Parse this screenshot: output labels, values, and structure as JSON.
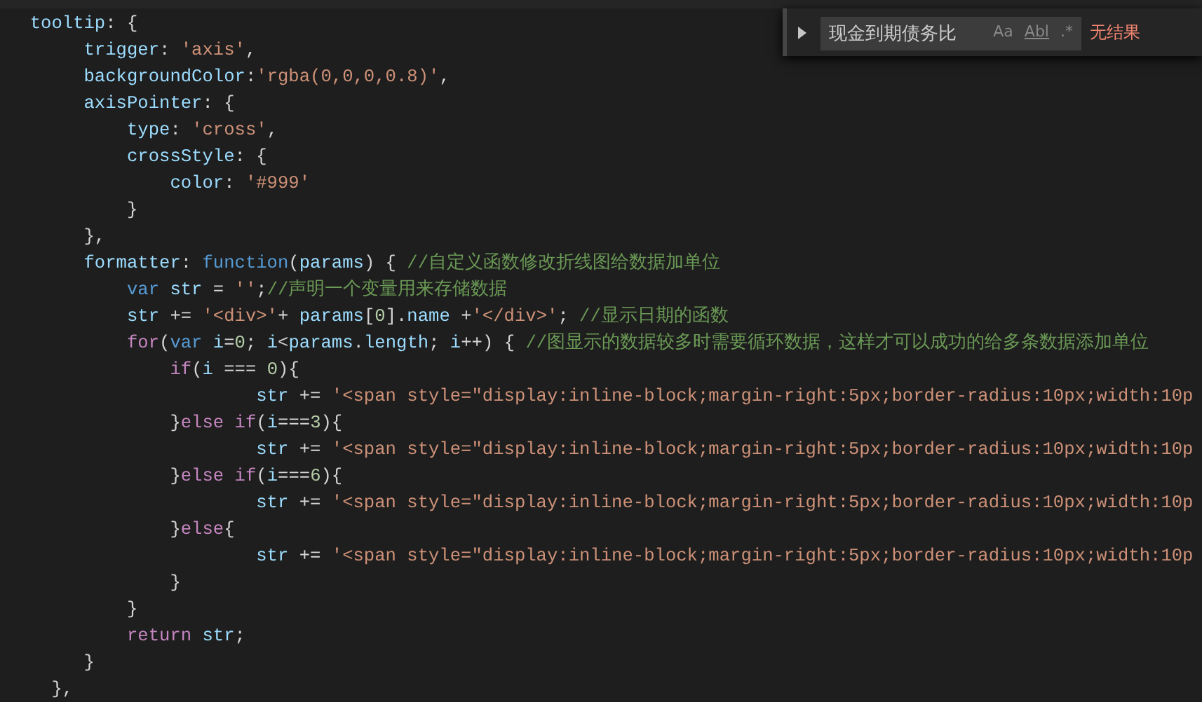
{
  "code_lines": [
    {
      "tokens": [
        {
          "kind": "prop",
          "text": "  tooltip"
        },
        {
          "kind": "plain",
          "text": ": {"
        }
      ]
    },
    {
      "tokens": [
        {
          "kind": "prop",
          "text": "       trigger"
        },
        {
          "kind": "plain",
          "text": ": "
        },
        {
          "kind": "str",
          "text": "'axis'"
        },
        {
          "kind": "plain",
          "text": ","
        }
      ]
    },
    {
      "tokens": [
        {
          "kind": "prop",
          "text": "       backgroundColor"
        },
        {
          "kind": "plain",
          "text": ":"
        },
        {
          "kind": "str",
          "text": "'rgba(0,0,0,0.8)'"
        },
        {
          "kind": "plain",
          "text": ","
        }
      ]
    },
    {
      "tokens": [
        {
          "kind": "prop",
          "text": "       axisPointer"
        },
        {
          "kind": "plain",
          "text": ": {"
        }
      ]
    },
    {
      "tokens": [
        {
          "kind": "prop",
          "text": "           type"
        },
        {
          "kind": "plain",
          "text": ": "
        },
        {
          "kind": "str",
          "text": "'cross'"
        },
        {
          "kind": "plain",
          "text": ","
        }
      ]
    },
    {
      "tokens": [
        {
          "kind": "prop",
          "text": "           crossStyle"
        },
        {
          "kind": "plain",
          "text": ": {"
        }
      ]
    },
    {
      "tokens": [
        {
          "kind": "prop",
          "text": "               color"
        },
        {
          "kind": "plain",
          "text": ": "
        },
        {
          "kind": "str",
          "text": "'#999'"
        }
      ]
    },
    {
      "tokens": [
        {
          "kind": "plain",
          "text": "           }"
        }
      ]
    },
    {
      "tokens": [
        {
          "kind": "plain",
          "text": "       },"
        }
      ]
    },
    {
      "tokens": [
        {
          "kind": "prop",
          "text": "       formatter"
        },
        {
          "kind": "plain",
          "text": ": "
        },
        {
          "kind": "kw",
          "text": "function"
        },
        {
          "kind": "plain",
          "text": "("
        },
        {
          "kind": "prop",
          "text": "params"
        },
        {
          "kind": "plain",
          "text": ") { "
        },
        {
          "kind": "comment",
          "text": "//自定义函数修改折线图给数据加单位"
        }
      ]
    },
    {
      "tokens": [
        {
          "kind": "kw",
          "text": "           var "
        },
        {
          "kind": "prop",
          "text": "str"
        },
        {
          "kind": "plain",
          "text": " = "
        },
        {
          "kind": "str",
          "text": "''"
        },
        {
          "kind": "plain",
          "text": ";"
        },
        {
          "kind": "comment",
          "text": "//声明一个变量用来存储数据"
        }
      ]
    },
    {
      "tokens": [
        {
          "kind": "prop",
          "text": "           str"
        },
        {
          "kind": "plain",
          "text": " += "
        },
        {
          "kind": "str",
          "text": "'<div>'"
        },
        {
          "kind": "plain",
          "text": "+ "
        },
        {
          "kind": "prop",
          "text": "params"
        },
        {
          "kind": "plain",
          "text": "["
        },
        {
          "kind": "num",
          "text": "0"
        },
        {
          "kind": "plain",
          "text": "]."
        },
        {
          "kind": "prop",
          "text": "name"
        },
        {
          "kind": "plain",
          "text": " +"
        },
        {
          "kind": "str",
          "text": "'</div>'"
        },
        {
          "kind": "plain",
          "text": "; "
        },
        {
          "kind": "comment",
          "text": "//显示日期的函数"
        }
      ]
    },
    {
      "tokens": [
        {
          "kind": "ctrl",
          "text": "           for"
        },
        {
          "kind": "plain",
          "text": "("
        },
        {
          "kind": "kw",
          "text": "var "
        },
        {
          "kind": "prop",
          "text": "i"
        },
        {
          "kind": "plain",
          "text": "="
        },
        {
          "kind": "num",
          "text": "0"
        },
        {
          "kind": "plain",
          "text": "; "
        },
        {
          "kind": "prop",
          "text": "i"
        },
        {
          "kind": "plain",
          "text": "<"
        },
        {
          "kind": "prop",
          "text": "params"
        },
        {
          "kind": "plain",
          "text": "."
        },
        {
          "kind": "prop",
          "text": "length"
        },
        {
          "kind": "plain",
          "text": "; "
        },
        {
          "kind": "prop",
          "text": "i"
        },
        {
          "kind": "plain",
          "text": "++) { "
        },
        {
          "kind": "comment",
          "text": "//图显示的数据较多时需要循环数据，这样才可以成功的给多条数据添加单位"
        }
      ]
    },
    {
      "tokens": [
        {
          "kind": "ctrl",
          "text": "               if"
        },
        {
          "kind": "plain",
          "text": "("
        },
        {
          "kind": "prop",
          "text": "i"
        },
        {
          "kind": "plain",
          "text": " === "
        },
        {
          "kind": "num",
          "text": "0"
        },
        {
          "kind": "plain",
          "text": "){"
        }
      ]
    },
    {
      "tokens": [
        {
          "kind": "prop",
          "text": "                       str"
        },
        {
          "kind": "plain",
          "text": " += "
        },
        {
          "kind": "str",
          "text": "'<span style=\"display:inline-block;margin-right:5px;border-radius:10px;width:10p"
        }
      ]
    },
    {
      "tokens": [
        {
          "kind": "plain",
          "text": "               }"
        },
        {
          "kind": "ctrl",
          "text": "else if"
        },
        {
          "kind": "plain",
          "text": "("
        },
        {
          "kind": "prop",
          "text": "i"
        },
        {
          "kind": "plain",
          "text": "==="
        },
        {
          "kind": "num",
          "text": "3"
        },
        {
          "kind": "plain",
          "text": "){"
        }
      ]
    },
    {
      "tokens": [
        {
          "kind": "prop",
          "text": "                       str"
        },
        {
          "kind": "plain",
          "text": " += "
        },
        {
          "kind": "str",
          "text": "'<span style=\"display:inline-block;margin-right:5px;border-radius:10px;width:10p"
        }
      ]
    },
    {
      "tokens": [
        {
          "kind": "plain",
          "text": "               }"
        },
        {
          "kind": "ctrl",
          "text": "else if"
        },
        {
          "kind": "plain",
          "text": "("
        },
        {
          "kind": "prop",
          "text": "i"
        },
        {
          "kind": "plain",
          "text": "==="
        },
        {
          "kind": "num",
          "text": "6"
        },
        {
          "kind": "plain",
          "text": "){"
        }
      ]
    },
    {
      "tokens": [
        {
          "kind": "prop",
          "text": "                       str"
        },
        {
          "kind": "plain",
          "text": " += "
        },
        {
          "kind": "str",
          "text": "'<span style=\"display:inline-block;margin-right:5px;border-radius:10px;width:10p"
        }
      ]
    },
    {
      "tokens": [
        {
          "kind": "plain",
          "text": "               }"
        },
        {
          "kind": "ctrl",
          "text": "else"
        },
        {
          "kind": "plain",
          "text": "{"
        }
      ]
    },
    {
      "tokens": [
        {
          "kind": "prop",
          "text": "                       str"
        },
        {
          "kind": "plain",
          "text": " += "
        },
        {
          "kind": "str",
          "text": "'<span style=\"display:inline-block;margin-right:5px;border-radius:10px;width:10p"
        }
      ]
    },
    {
      "tokens": [
        {
          "kind": "plain",
          "text": "               }"
        }
      ]
    },
    {
      "tokens": [
        {
          "kind": "plain",
          "text": "           }"
        }
      ]
    },
    {
      "tokens": [
        {
          "kind": "ctrl",
          "text": "           return "
        },
        {
          "kind": "prop",
          "text": "str"
        },
        {
          "kind": "plain",
          "text": ";"
        }
      ]
    },
    {
      "tokens": [
        {
          "kind": "plain",
          "text": "       }"
        }
      ]
    },
    {
      "tokens": [
        {
          "kind": "plain",
          "text": "    },"
        }
      ]
    }
  ],
  "find_widget": {
    "value": "现金到期债务比",
    "options": [
      "Aa",
      "Abl",
      ".*"
    ],
    "result": "无结果"
  }
}
